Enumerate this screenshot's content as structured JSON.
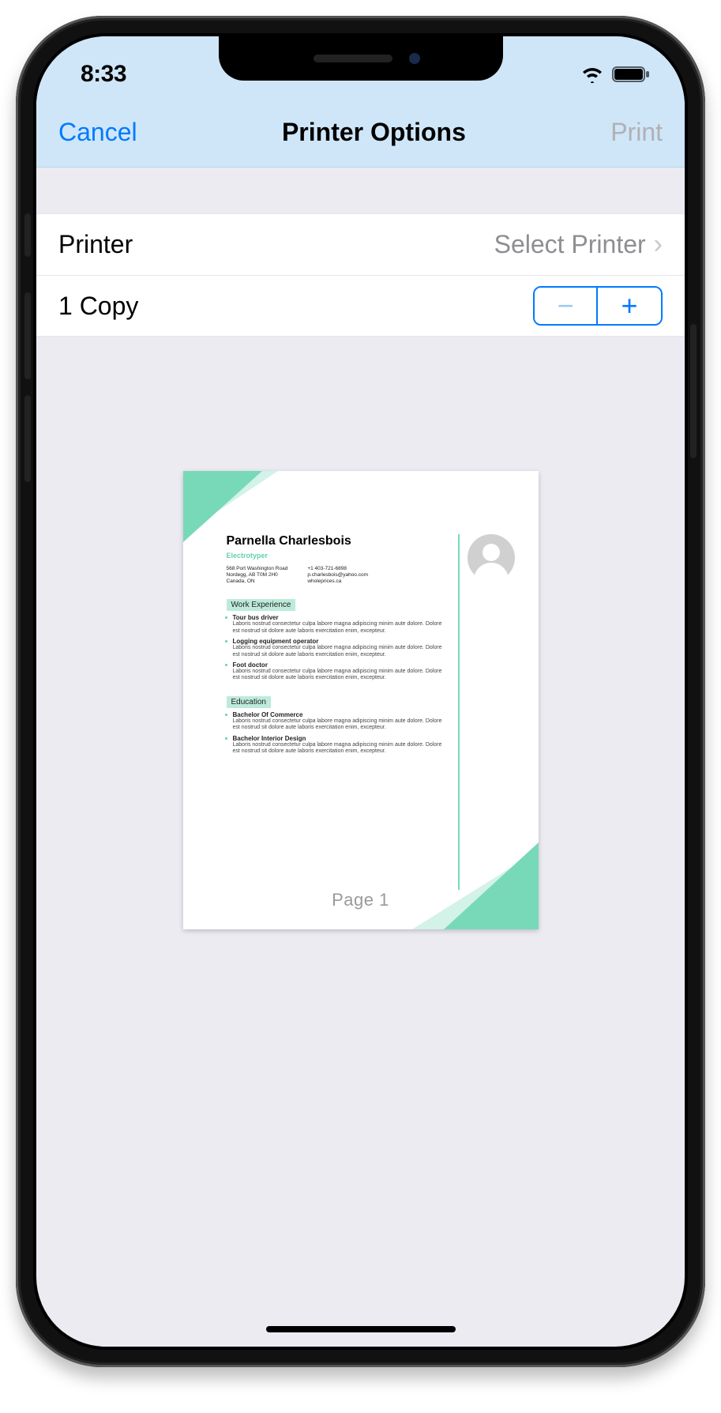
{
  "status": {
    "time": "8:33"
  },
  "nav": {
    "cancel": "Cancel",
    "title": "Printer Options",
    "print": "Print"
  },
  "rows": {
    "printer_label": "Printer",
    "printer_value": "Select Printer",
    "copies_label": "1 Copy"
  },
  "preview": {
    "page_label": "Page 1",
    "resume": {
      "name": "Parnella Charlesbois",
      "role": "Electrotyper",
      "addr1": "568 Port Washington Road",
      "addr2": "Nordegg, AB T0M 2H0",
      "addr3": "Canada, ON",
      "phone": "+1 403-721-6898",
      "email": "p.charlesbois@yahoo.com",
      "site": "wholeprices.ca",
      "section_work": "Work Experience",
      "work": [
        {
          "title": "Tour bus driver",
          "desc": "Laboris nostrud consectetur culpa labore magna adipiscing minim aute dolore. Dolore est nostrud sit dolore aute laboris exercitation enim, excepteur."
        },
        {
          "title": "Logging equipment operator",
          "desc": "Laboris nostrud consectetur culpa labore magna adipiscing minim aute dolore. Dolore est nostrud sit dolore aute laboris exercitation enim, excepteur."
        },
        {
          "title": "Foot doctor",
          "desc": "Laboris nostrud consectetur culpa labore magna adipiscing minim aute dolore. Dolore est nostrud sit dolore aute laboris exercitation enim, excepteur."
        }
      ],
      "section_edu": "Education",
      "edu": [
        {
          "title": "Bachelor Of Commerce",
          "desc": "Laboris nostrud consectetur culpa labore magna adipiscing minim aute dolore. Dolore est nostrud sit dolore aute laboris exercitation enim, excepteur."
        },
        {
          "title": "Bachelor Interior Design",
          "desc": "Laboris nostrud consectetur culpa labore magna adipiscing minim aute dolore. Dolore est nostrud sit dolore aute laboris exercitation enim, excepteur."
        }
      ]
    }
  }
}
